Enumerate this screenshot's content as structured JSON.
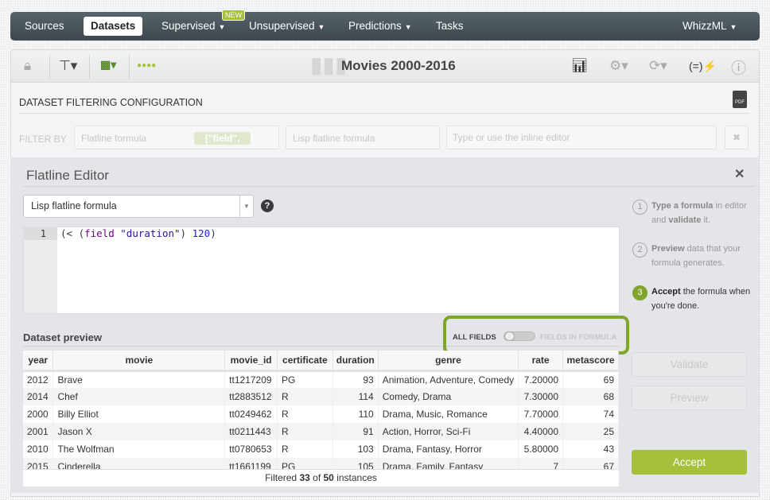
{
  "nav": {
    "items": [
      "Sources",
      "Datasets",
      "Supervised",
      "Unsupervised",
      "Predictions",
      "Tasks"
    ],
    "right": "WhizzML",
    "new_badge": "NEW"
  },
  "toolbar": {
    "title": "Movies 2000-2016"
  },
  "config": {
    "title": "DATASET FILTERING CONFIGURATION",
    "filter_by": "FILTER BY",
    "formula_type": "Flatline formula",
    "formula_chip": "[\"field\",",
    "lisp_select": "Lisp flatline formula",
    "inline_placeholder": "Type or use the inline editor",
    "pdf_label": "PDF"
  },
  "editor": {
    "title": "Flatline Editor",
    "select_value": "Lisp flatline formula",
    "line_number": "1",
    "code": {
      "p1": "(< (",
      "kw": "field",
      "p2": " ",
      "str": "\"duration\"",
      "p3": ") ",
      "num": "120",
      "p4": ")"
    }
  },
  "preview": {
    "label": "Dataset preview",
    "all_fields": "ALL FIELDS",
    "fields_in_formula": "FIELDS IN FORMULA",
    "toggle_state": "all fields",
    "columns": [
      "year",
      "movie",
      "movie_id",
      "certificate",
      "duration",
      "genre",
      "rate",
      "metascore"
    ],
    "rows": [
      [
        "2012",
        "Brave",
        "tt1217209",
        "PG",
        "93",
        "Animation, Adventure, Comedy",
        "7.20000",
        "69"
      ],
      [
        "2014",
        "Chef",
        "tt2883512",
        "R",
        "114",
        "Comedy, Drama",
        "7.30000",
        "68"
      ],
      [
        "2000",
        "Billy Elliot",
        "tt0249462",
        "R",
        "110",
        "Drama, Music, Romance",
        "7.70000",
        "74"
      ],
      [
        "2001",
        "Jason X",
        "tt0211443",
        "R",
        "91",
        "Action, Horror, Sci-Fi",
        "4.40000",
        "25"
      ],
      [
        "2010",
        "The Wolfman",
        "tt0780653",
        "R",
        "103",
        "Drama, Fantasy, Horror",
        "5.80000",
        "43"
      ],
      [
        "2015",
        "Cinderella",
        "tt1661199",
        "PG",
        "105",
        "Drama, Family, Fantasy",
        "7",
        "67"
      ]
    ],
    "footer": {
      "pre": "Filtered ",
      "count": "33",
      "mid": " of ",
      "total": "50",
      "post": " instances"
    }
  },
  "steps": [
    {
      "num": "1",
      "b1": "Type a formula",
      "t1": " in editor and ",
      "b2": "validate",
      "t2": " it."
    },
    {
      "num": "2",
      "b1": "Preview",
      "t1": " data that your formula generates."
    },
    {
      "num": "3",
      "b1": "Accept",
      "t1": " the formula when you're done."
    }
  ],
  "buttons": {
    "validate": "Validate",
    "preview": "Preview",
    "accept": "Accept"
  },
  "colors": {
    "accent": "#a5c13b",
    "highlight": "#7fa52d",
    "navbar": "#4a555c"
  }
}
